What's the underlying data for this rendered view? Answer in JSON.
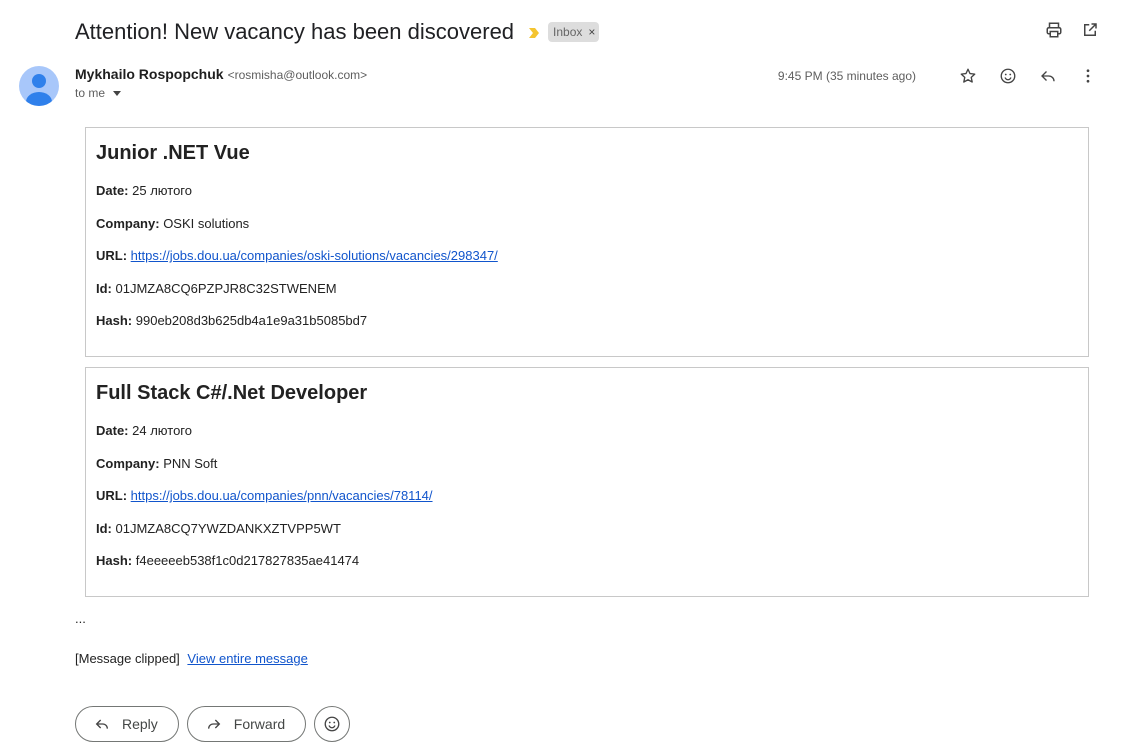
{
  "subject": "Attention! New vacancy has been discovered",
  "label": "Inbox",
  "sender": {
    "name": "Mykhailo Rospopchuk",
    "email": "<rosmisha@outlook.com>",
    "recipient": "to me"
  },
  "timestamp": "9:45 PM (35 minutes ago)",
  "vacancies": [
    {
      "title": "Junior .NET Vue",
      "date_label": "Date:",
      "date": "25 лютого",
      "company_label": "Company:",
      "company": "OSKI solutions",
      "url_label": "URL:",
      "url": "https://jobs.dou.ua/companies/oski-solutions/vacancies/298347/",
      "id_label": "Id:",
      "id": "01JMZA8CQ6PZPJR8C32STWENEM",
      "hash_label": "Hash:",
      "hash": "990eb208d3b625db4a1e9a31b5085bd7"
    },
    {
      "title": "Full Stack C#/.Net Developer",
      "date_label": "Date:",
      "date": "24 лютого",
      "company_label": "Company:",
      "company": "PNN Soft",
      "url_label": "URL:",
      "url": "https://jobs.dou.ua/companies/pnn/vacancies/78114/",
      "id_label": "Id:",
      "id": "01JMZA8CQ7YWZDANKXZTVPP5WT",
      "hash_label": "Hash:",
      "hash": "f4eeeeeb538f1c0d217827835ae41474"
    }
  ],
  "ellipsis": "...",
  "clipped": {
    "text": "[Message clipped]",
    "link": "View entire message"
  },
  "actions": {
    "reply": "Reply",
    "forward": "Forward"
  },
  "colors": {
    "link": "#1155cc",
    "importance": "#f4c430",
    "avatar_bg": "#a8c7fa"
  }
}
